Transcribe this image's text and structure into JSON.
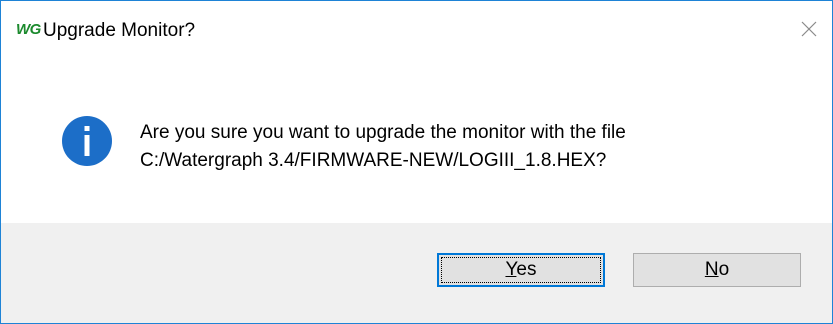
{
  "dialog": {
    "app_logo": "WG",
    "title": "Upgrade Monitor?",
    "message_line1": "Are you sure you want to upgrade the monitor with the file",
    "message_line2": "C:/Watergraph 3.4/FIRMWARE-NEW/LOGIII_1.8.HEX?",
    "icon": "info-icon",
    "buttons": {
      "yes_label": "Yes",
      "no_label": "No"
    },
    "colors": {
      "accent": "#0078d7",
      "info_icon": "#1c6ec8",
      "logo": "#1c8a2e",
      "footer_bg": "#f0f0f0"
    }
  }
}
